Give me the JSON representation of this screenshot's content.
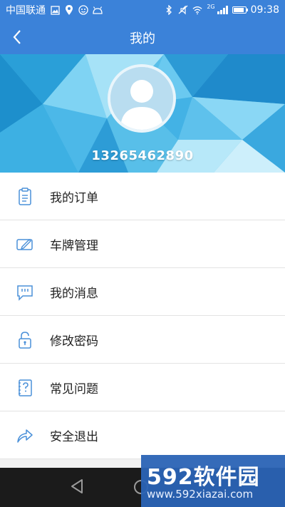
{
  "status_bar": {
    "carrier": "中国联通",
    "network_badge": "2G",
    "time": "09:38"
  },
  "app_bar": {
    "title": "我的"
  },
  "profile": {
    "phone": "13265462890"
  },
  "menu": {
    "items": [
      {
        "label": "我的订单",
        "icon": "clipboard-icon"
      },
      {
        "label": "车牌管理",
        "icon": "edit-card-icon"
      },
      {
        "label": "我的消息",
        "icon": "message-icon"
      },
      {
        "label": "修改密码",
        "icon": "lock-icon"
      },
      {
        "label": "常见问题",
        "icon": "question-book-icon"
      },
      {
        "label": "安全退出",
        "icon": "share-arrow-icon"
      }
    ]
  },
  "watermark": {
    "brand": "592软件园",
    "url": "www.592xiazai.com"
  },
  "colors": {
    "primary": "#3b82d9",
    "icon_blue": "#4a90d9",
    "banner_blue": "#4cb4e6"
  }
}
